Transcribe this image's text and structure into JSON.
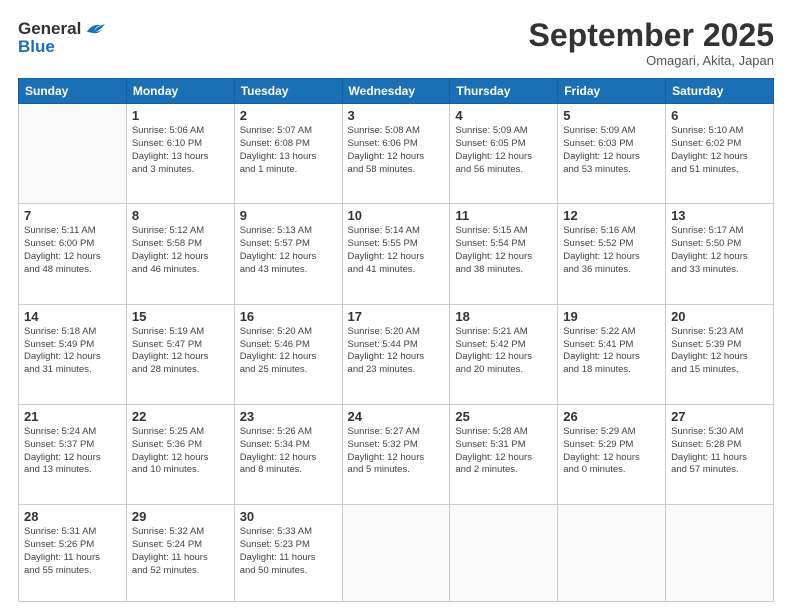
{
  "header": {
    "logo_general": "General",
    "logo_blue": "Blue",
    "month": "September 2025",
    "location": "Omagari, Akita, Japan"
  },
  "weekdays": [
    "Sunday",
    "Monday",
    "Tuesday",
    "Wednesday",
    "Thursday",
    "Friday",
    "Saturday"
  ],
  "weeks": [
    [
      {
        "day": "",
        "info": ""
      },
      {
        "day": "1",
        "info": "Sunrise: 5:06 AM\nSunset: 6:10 PM\nDaylight: 13 hours\nand 3 minutes."
      },
      {
        "day": "2",
        "info": "Sunrise: 5:07 AM\nSunset: 6:08 PM\nDaylight: 13 hours\nand 1 minute."
      },
      {
        "day": "3",
        "info": "Sunrise: 5:08 AM\nSunset: 6:06 PM\nDaylight: 12 hours\nand 58 minutes."
      },
      {
        "day": "4",
        "info": "Sunrise: 5:09 AM\nSunset: 6:05 PM\nDaylight: 12 hours\nand 56 minutes."
      },
      {
        "day": "5",
        "info": "Sunrise: 5:09 AM\nSunset: 6:03 PM\nDaylight: 12 hours\nand 53 minutes."
      },
      {
        "day": "6",
        "info": "Sunrise: 5:10 AM\nSunset: 6:02 PM\nDaylight: 12 hours\nand 51 minutes."
      }
    ],
    [
      {
        "day": "7",
        "info": "Sunrise: 5:11 AM\nSunset: 6:00 PM\nDaylight: 12 hours\nand 48 minutes."
      },
      {
        "day": "8",
        "info": "Sunrise: 5:12 AM\nSunset: 5:58 PM\nDaylight: 12 hours\nand 46 minutes."
      },
      {
        "day": "9",
        "info": "Sunrise: 5:13 AM\nSunset: 5:57 PM\nDaylight: 12 hours\nand 43 minutes."
      },
      {
        "day": "10",
        "info": "Sunrise: 5:14 AM\nSunset: 5:55 PM\nDaylight: 12 hours\nand 41 minutes."
      },
      {
        "day": "11",
        "info": "Sunrise: 5:15 AM\nSunset: 5:54 PM\nDaylight: 12 hours\nand 38 minutes."
      },
      {
        "day": "12",
        "info": "Sunrise: 5:16 AM\nSunset: 5:52 PM\nDaylight: 12 hours\nand 36 minutes."
      },
      {
        "day": "13",
        "info": "Sunrise: 5:17 AM\nSunset: 5:50 PM\nDaylight: 12 hours\nand 33 minutes."
      }
    ],
    [
      {
        "day": "14",
        "info": "Sunrise: 5:18 AM\nSunset: 5:49 PM\nDaylight: 12 hours\nand 31 minutes."
      },
      {
        "day": "15",
        "info": "Sunrise: 5:19 AM\nSunset: 5:47 PM\nDaylight: 12 hours\nand 28 minutes."
      },
      {
        "day": "16",
        "info": "Sunrise: 5:20 AM\nSunset: 5:46 PM\nDaylight: 12 hours\nand 25 minutes."
      },
      {
        "day": "17",
        "info": "Sunrise: 5:20 AM\nSunset: 5:44 PM\nDaylight: 12 hours\nand 23 minutes."
      },
      {
        "day": "18",
        "info": "Sunrise: 5:21 AM\nSunset: 5:42 PM\nDaylight: 12 hours\nand 20 minutes."
      },
      {
        "day": "19",
        "info": "Sunrise: 5:22 AM\nSunset: 5:41 PM\nDaylight: 12 hours\nand 18 minutes."
      },
      {
        "day": "20",
        "info": "Sunrise: 5:23 AM\nSunset: 5:39 PM\nDaylight: 12 hours\nand 15 minutes."
      }
    ],
    [
      {
        "day": "21",
        "info": "Sunrise: 5:24 AM\nSunset: 5:37 PM\nDaylight: 12 hours\nand 13 minutes."
      },
      {
        "day": "22",
        "info": "Sunrise: 5:25 AM\nSunset: 5:36 PM\nDaylight: 12 hours\nand 10 minutes."
      },
      {
        "day": "23",
        "info": "Sunrise: 5:26 AM\nSunset: 5:34 PM\nDaylight: 12 hours\nand 8 minutes."
      },
      {
        "day": "24",
        "info": "Sunrise: 5:27 AM\nSunset: 5:32 PM\nDaylight: 12 hours\nand 5 minutes."
      },
      {
        "day": "25",
        "info": "Sunrise: 5:28 AM\nSunset: 5:31 PM\nDaylight: 12 hours\nand 2 minutes."
      },
      {
        "day": "26",
        "info": "Sunrise: 5:29 AM\nSunset: 5:29 PM\nDaylight: 12 hours\nand 0 minutes."
      },
      {
        "day": "27",
        "info": "Sunrise: 5:30 AM\nSunset: 5:28 PM\nDaylight: 11 hours\nand 57 minutes."
      }
    ],
    [
      {
        "day": "28",
        "info": "Sunrise: 5:31 AM\nSunset: 5:26 PM\nDaylight: 11 hours\nand 55 minutes."
      },
      {
        "day": "29",
        "info": "Sunrise: 5:32 AM\nSunset: 5:24 PM\nDaylight: 11 hours\nand 52 minutes."
      },
      {
        "day": "30",
        "info": "Sunrise: 5:33 AM\nSunset: 5:23 PM\nDaylight: 11 hours\nand 50 minutes."
      },
      {
        "day": "",
        "info": ""
      },
      {
        "day": "",
        "info": ""
      },
      {
        "day": "",
        "info": ""
      },
      {
        "day": "",
        "info": ""
      }
    ]
  ]
}
